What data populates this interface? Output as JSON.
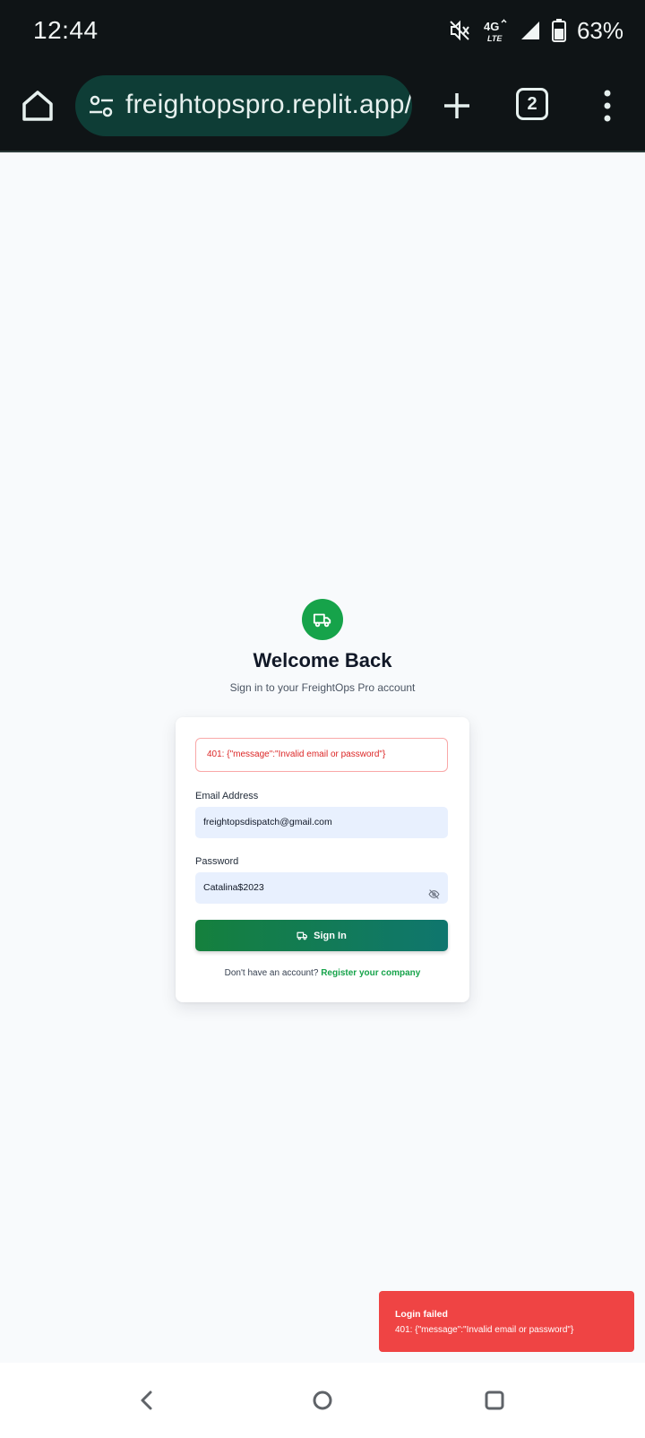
{
  "status_bar": {
    "time": "12:44",
    "network": "4G LTE",
    "battery": "63%"
  },
  "browser": {
    "url": "freightopspro.replit.app/",
    "tab_count": "2"
  },
  "login": {
    "title": "Welcome Back",
    "subtitle": "Sign in to your FreightOps Pro account",
    "error": "401: {\"message\":\"Invalid email or password\"}",
    "email_label": "Email Address",
    "email_value": "freightopsdispatch@gmail.com",
    "password_label": "Password",
    "password_value": "Catalina$2023",
    "signin_label": "Sign In",
    "register_prompt": "Don't have an account?",
    "register_link": "Register your company"
  },
  "toast": {
    "title": "Login failed",
    "message": "401: {\"message\":\"Invalid email or password\"}"
  },
  "colors": {
    "brand": "#16a34a",
    "error": "#ef4444",
    "toolbar": "#0f1416",
    "url_pill": "#0e3d36"
  }
}
